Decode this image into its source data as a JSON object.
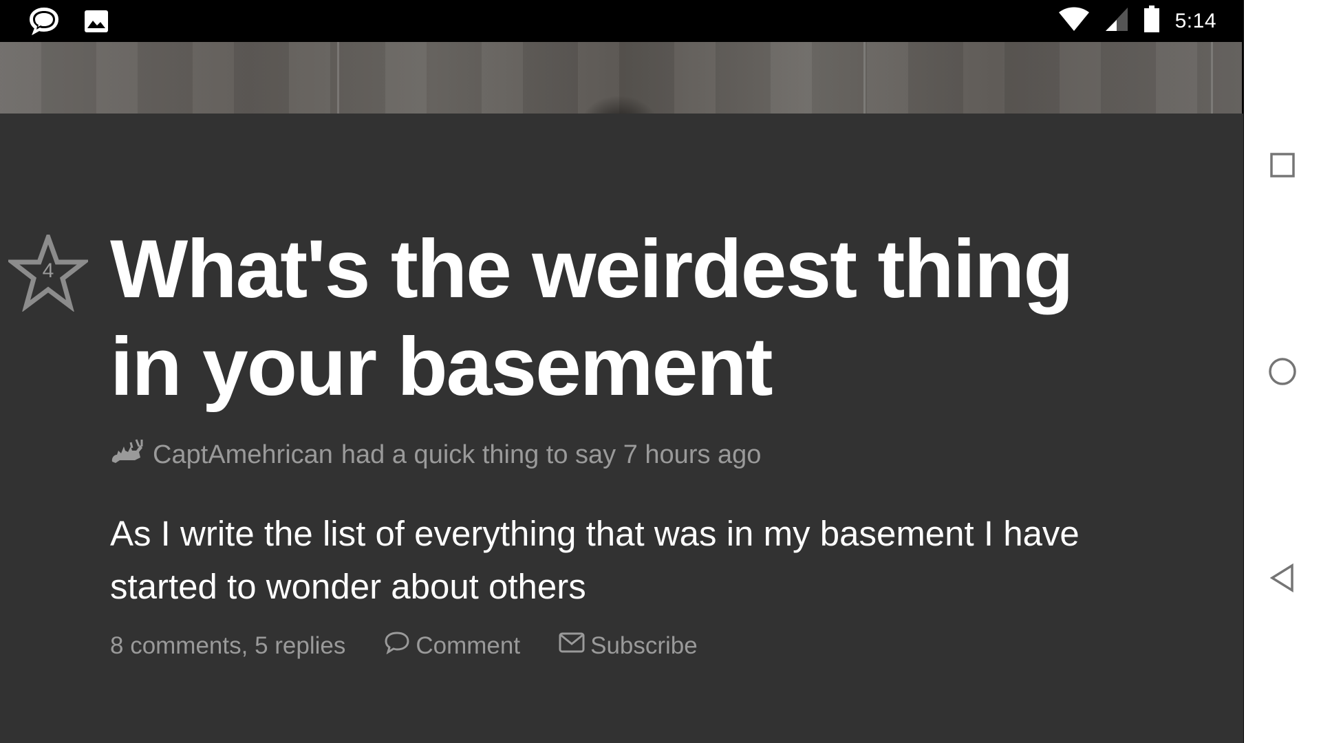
{
  "status_bar": {
    "time": "5:14",
    "left_icons": [
      "chat-bubble-icon",
      "image-icon"
    ],
    "right_icons": [
      "wifi-icon",
      "cell-signal-icon",
      "battery-icon"
    ]
  },
  "post": {
    "star_count": "4",
    "title": "What's the weirdest thing in your basement",
    "author": "CaptAmehrican",
    "meta_text": "had a quick thing to say 7 hours ago",
    "body": "As I write the list of everything that was in my basement I have started to wonder about others",
    "stats": "8 comments, 5 replies",
    "comment_label": "Comment",
    "subscribe_label": "Subscribe"
  },
  "nav": {
    "buttons": [
      "recents-square-icon",
      "home-circle-icon",
      "back-triangle-icon"
    ]
  },
  "colors": {
    "content_bg": "#323232",
    "text_primary": "#ffffff",
    "text_muted": "#9a9a9a",
    "nav_bg": "#ffffff",
    "status_bg": "#000000"
  }
}
